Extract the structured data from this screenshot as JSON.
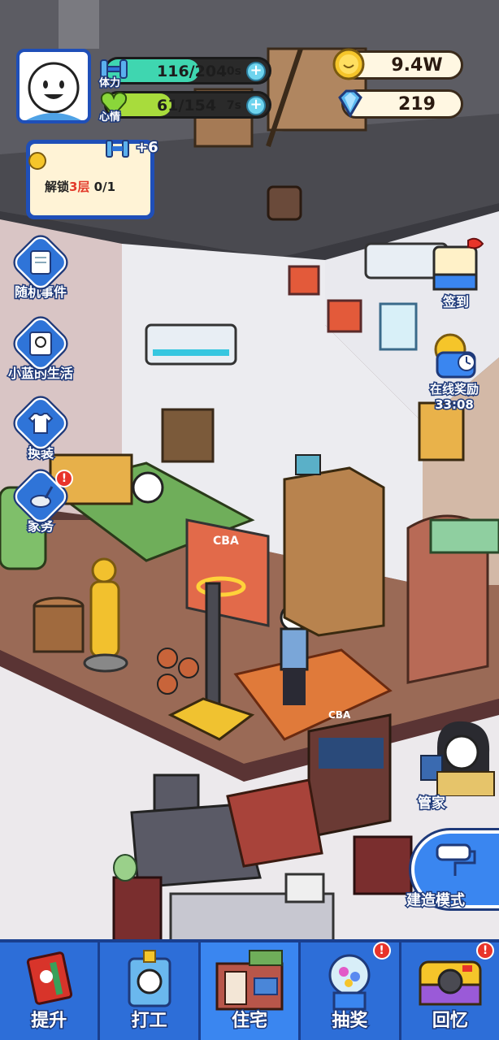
{
  "hud": {
    "stamina": {
      "label": "体力",
      "value": "116/204",
      "timer": "10s",
      "fraction": 0.57
    },
    "mood": {
      "label": "心情",
      "value": "61/154",
      "timer": "7s",
      "fraction": 0.4
    },
    "coins": "9.4W",
    "diamonds": "219"
  },
  "quest": {
    "bonus": "+6",
    "text_prefix": "解锁",
    "text_highlight": "3层",
    "text_suffix": " 0/1"
  },
  "left_menu": [
    {
      "label": "随机事件"
    },
    {
      "label": "小蓝的生活"
    },
    {
      "label": "换装"
    },
    {
      "label": "家务",
      "alert": "!"
    }
  ],
  "right_menu": {
    "checkin": "签到",
    "online_reward": "在线奖励",
    "online_timer": "33:08",
    "butler": "管家",
    "build_mode": "建造模式"
  },
  "scene_text": {
    "hoop_logo": "CBA",
    "rug_logo": "CBA"
  },
  "nav": [
    {
      "label": "提升",
      "active": false
    },
    {
      "label": "打工",
      "active": false
    },
    {
      "label": "住宅",
      "active": true
    },
    {
      "label": "抽奖",
      "active": false,
      "alert": "!"
    },
    {
      "label": "回忆",
      "active": false,
      "alert": "!"
    }
  ],
  "colors": {
    "stamina": "#3fd6b0",
    "mood": "#a8dc3c",
    "nav_bg": "#2d6ed8",
    "accent_red": "#e8342a"
  }
}
